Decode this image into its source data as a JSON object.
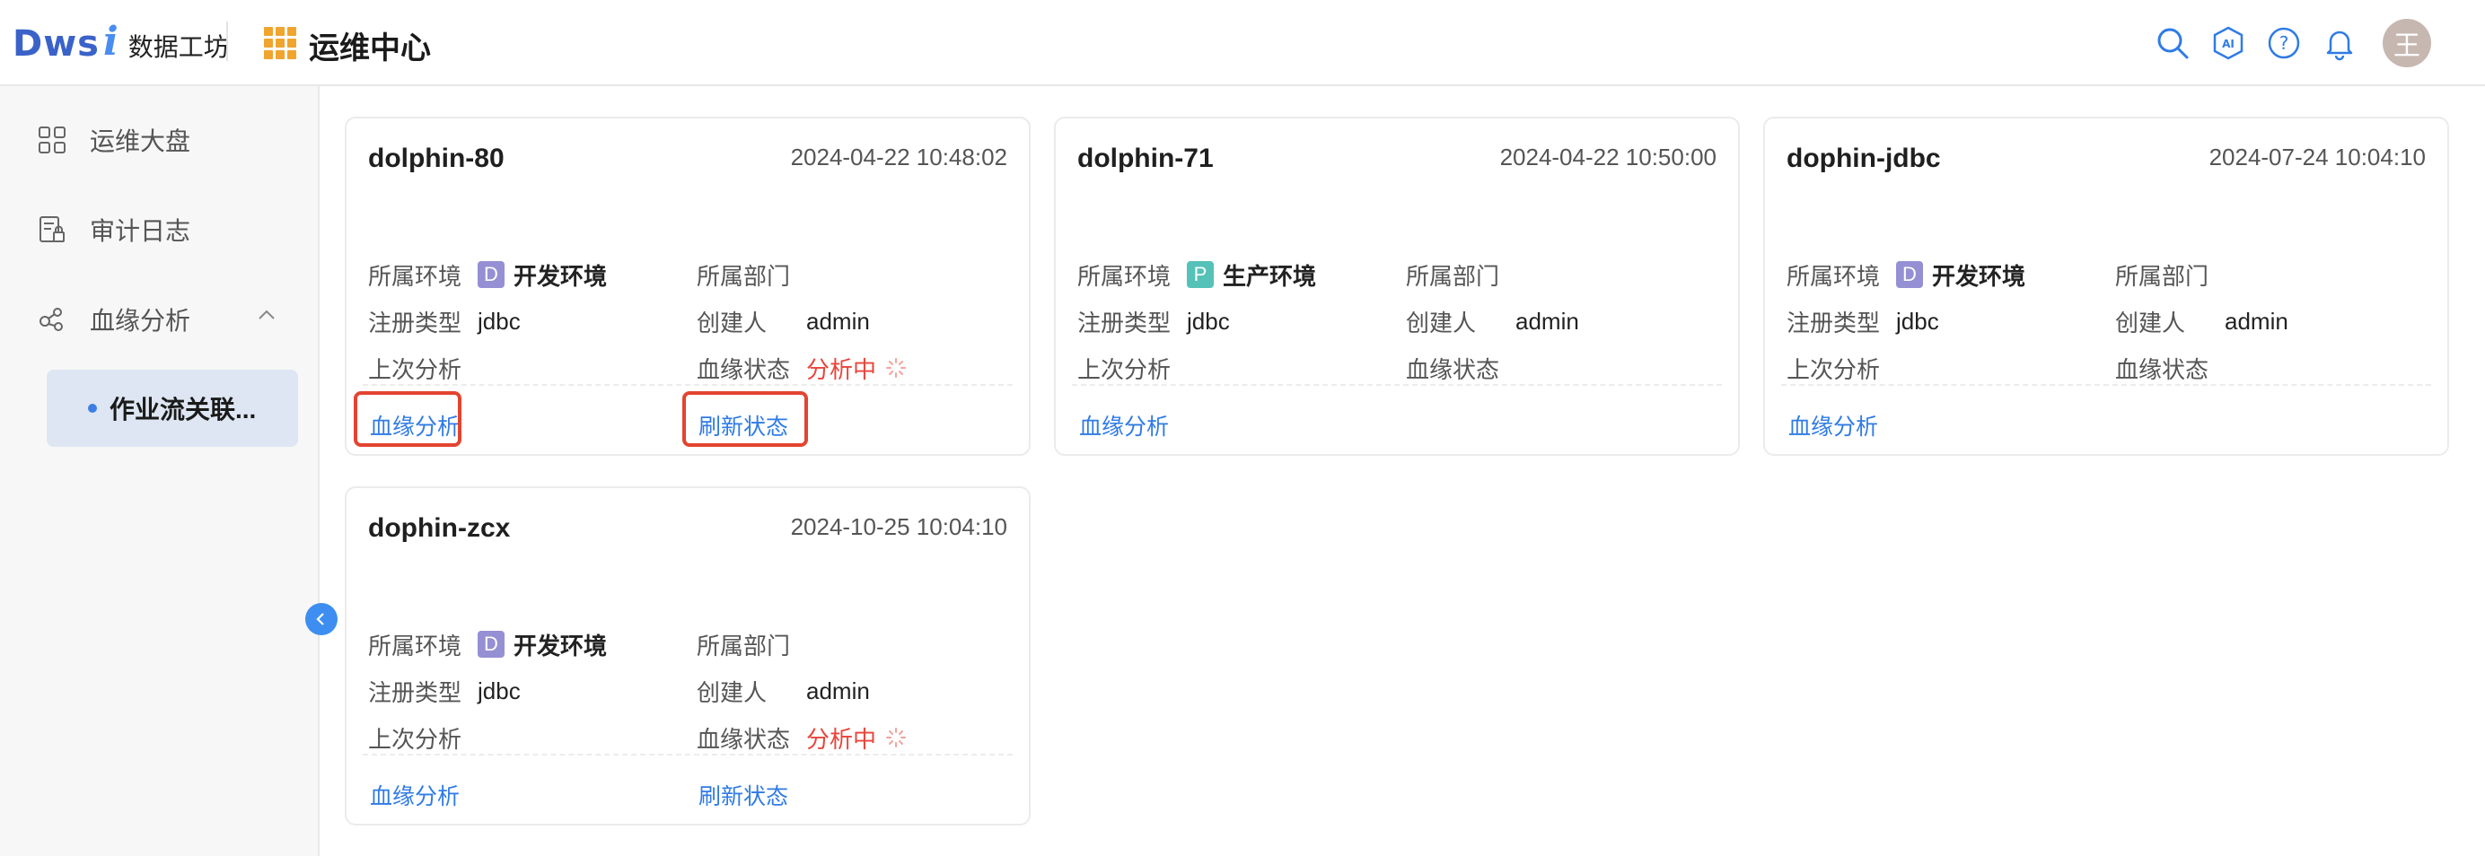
{
  "header": {
    "logo_letters": [
      "D",
      "w",
      "s",
      "i"
    ],
    "logo_name": "数据工坊",
    "module_title": "运维中心",
    "icons": [
      "search-icon",
      "ai-icon",
      "help-icon",
      "bell-icon"
    ],
    "avatar_text": "王"
  },
  "sidebar": {
    "items": [
      {
        "label": "运维大盘",
        "icon": "dashboard-icon"
      },
      {
        "label": "审计日志",
        "icon": "audit-log-icon"
      },
      {
        "label": "血缘分析",
        "icon": "lineage-icon",
        "expanded": true
      }
    ],
    "sub_item": {
      "label": "作业流关联..."
    }
  },
  "labels": {
    "env": "所属环境",
    "type": "注册类型",
    "last": "上次分析",
    "dept": "所属部门",
    "creator": "创建人",
    "lineage_status": "血缘状态"
  },
  "cards": [
    {
      "name": "dolphin-80",
      "time": "2024-04-22 10:48:02",
      "env_badge": "D",
      "env_name": "开发环境",
      "env_color": "#9590d4",
      "type": "jdbc",
      "last": "",
      "dept": "",
      "creator": "admin",
      "status": "分析中",
      "actions": [
        "血缘分析",
        "刷新状态"
      ]
    },
    {
      "name": "dolphin-71",
      "time": "2024-04-22 10:50:00",
      "env_badge": "P",
      "env_name": "生产环境",
      "env_color": "#55c2b8",
      "type": "jdbc",
      "last": "",
      "dept": "",
      "creator": "admin",
      "status": "",
      "actions": [
        "血缘分析"
      ]
    },
    {
      "name": "dophin-jdbc",
      "time": "2024-07-24 10:04:10",
      "env_badge": "D",
      "env_name": "开发环境",
      "env_color": "#9590d4",
      "type": "jdbc",
      "last": "",
      "dept": "",
      "creator": "admin",
      "status": "",
      "actions": [
        "血缘分析"
      ]
    },
    {
      "name": "dophin-zcx",
      "time": "2024-10-25 10:04:10",
      "env_badge": "D",
      "env_name": "开发环境",
      "env_color": "#9590d4",
      "type": "jdbc",
      "last": "",
      "dept": "",
      "creator": "admin",
      "status": "分析中",
      "actions": [
        "血缘分析",
        "刷新状态"
      ]
    }
  ],
  "colors": {
    "accent": "#2f7be5",
    "status_analyzing": "#e9453a",
    "highlight": "#e3442f"
  }
}
